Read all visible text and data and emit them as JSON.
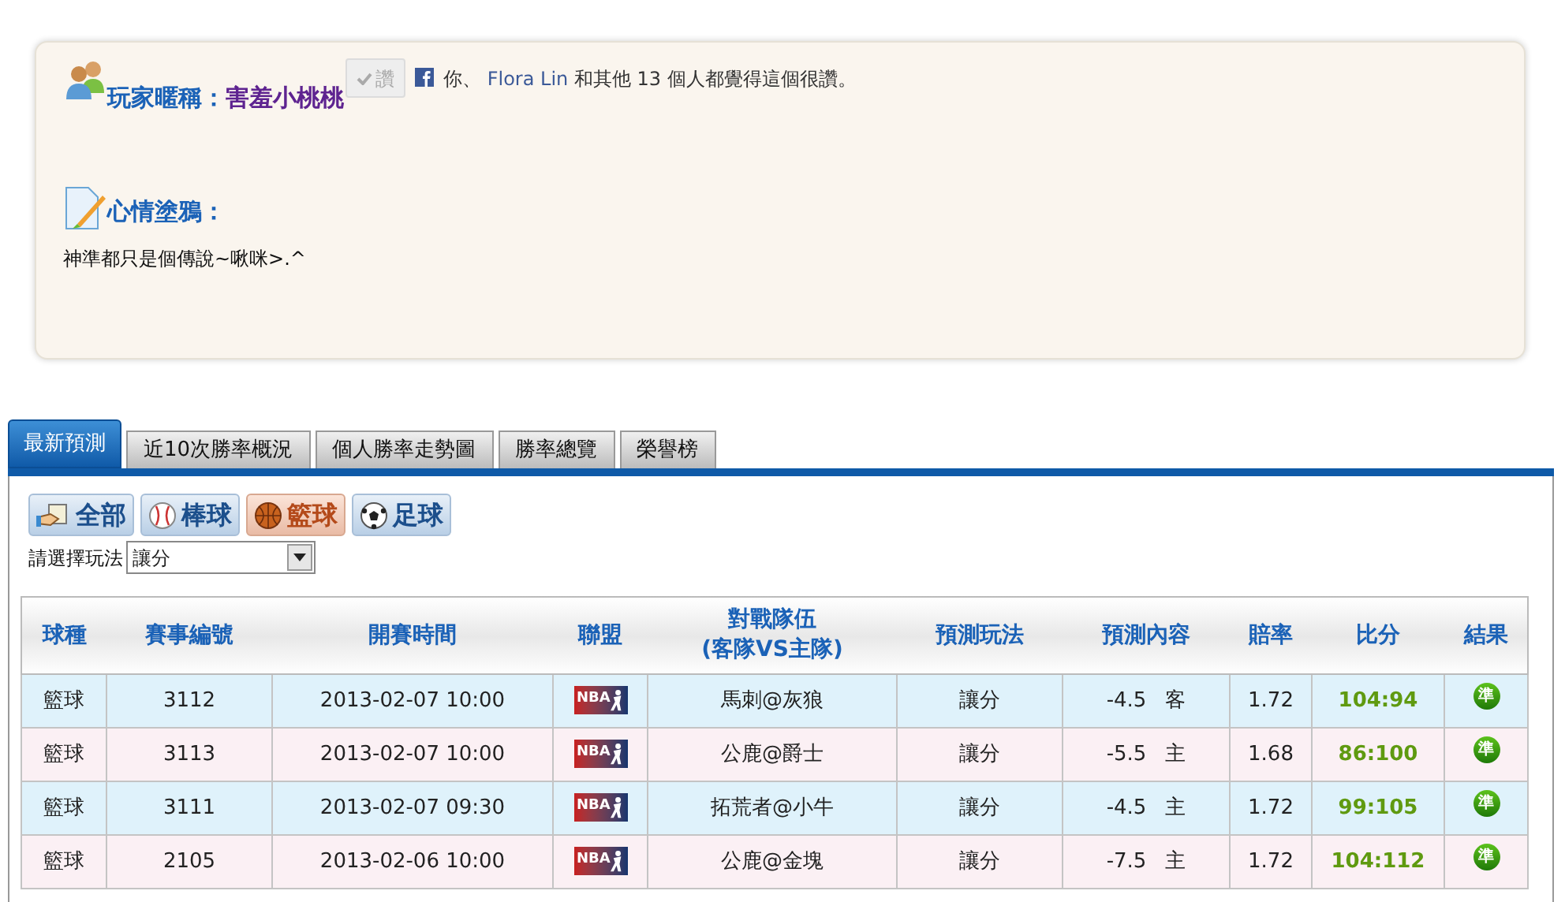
{
  "profile": {
    "nickname_label": "玩家暱稱：",
    "nickname": "害羞小桃桃",
    "like_button": "讚",
    "like_prefix": "你、",
    "like_link": "Flora Lin",
    "like_suffix": "和其他 13 個人都覺得這個很讚。",
    "mood_label": "心情塗鴉：",
    "mood_text": "神準都只是個傳說~啾咪>.^"
  },
  "tabs": [
    {
      "label": "最新預測",
      "selected": true
    },
    {
      "label": "近10次勝率概況",
      "selected": false
    },
    {
      "label": "個人勝率走勢圖",
      "selected": false
    },
    {
      "label": "勝率總覽",
      "selected": false
    },
    {
      "label": "榮譽榜",
      "selected": false
    }
  ],
  "sport_buttons": [
    {
      "label": "全部",
      "kind": "all",
      "selected": false
    },
    {
      "label": "棒球",
      "kind": "baseball",
      "selected": false
    },
    {
      "label": "籃球",
      "kind": "basketball",
      "selected": true
    },
    {
      "label": "足球",
      "kind": "soccer",
      "selected": false
    }
  ],
  "play_select": {
    "label": "請選擇玩法",
    "value": "讓分"
  },
  "table": {
    "columns": [
      "球種",
      "賽事編號",
      "開賽時間",
      "聯盟",
      "對戰隊伍\n(客隊VS主隊)",
      "預測玩法",
      "預測內容",
      "賠率",
      "比分",
      "結果"
    ],
    "rows": [
      {
        "sport": "籃球",
        "game_no": "3112",
        "time": "2013-02-07 10:00",
        "league": "NBA",
        "match": "馬刺@灰狼",
        "play": "讓分",
        "line": "-4.5",
        "side": "客",
        "odds": "1.72",
        "score": "104:94",
        "result": "準"
      },
      {
        "sport": "籃球",
        "game_no": "3113",
        "time": "2013-02-07 10:00",
        "league": "NBA",
        "match": "公鹿@爵士",
        "play": "讓分",
        "line": "-5.5",
        "side": "主",
        "odds": "1.68",
        "score": "86:100",
        "result": "準"
      },
      {
        "sport": "籃球",
        "game_no": "3111",
        "time": "2013-02-07 09:30",
        "league": "NBA",
        "match": "拓荒者@小牛",
        "play": "讓分",
        "line": "-4.5",
        "side": "主",
        "odds": "1.72",
        "score": "99:105",
        "result": "準"
      },
      {
        "sport": "籃球",
        "game_no": "2105",
        "time": "2013-02-06 10:00",
        "league": "NBA",
        "match": "公鹿@金塊",
        "play": "讓分",
        "line": "-7.5",
        "side": "主",
        "odds": "1.72",
        "score": "104:112",
        "result": "準"
      }
    ]
  }
}
